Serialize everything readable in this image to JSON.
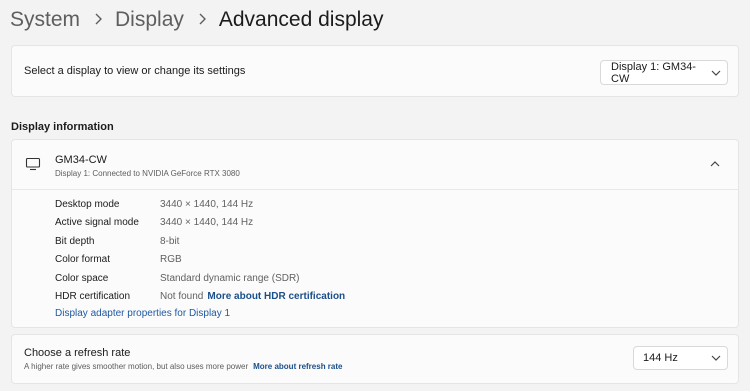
{
  "breadcrumb": {
    "items": [
      "System",
      "Display"
    ],
    "current": "Advanced display"
  },
  "display_select": {
    "label": "Select a display to view or change its settings",
    "value": "Display 1: GM34-CW"
  },
  "display_info": {
    "heading": "Display information",
    "name": "GM34-CW",
    "description": "Display 1: Connected to NVIDIA GeForce RTX 3080",
    "rows": [
      {
        "label": "Desktop mode",
        "value": "3440 × 1440, 144 Hz"
      },
      {
        "label": "Active signal mode",
        "value": "3440 × 1440, 144 Hz"
      },
      {
        "label": "Bit depth",
        "value": "8-bit"
      },
      {
        "label": "Color format",
        "value": "RGB"
      },
      {
        "label": "Color space",
        "value": "Standard dynamic range (SDR)"
      },
      {
        "label": "HDR certification",
        "value": "Not found",
        "link": "More about HDR certification"
      }
    ],
    "adapter_link": "Display adapter properties for Display 1"
  },
  "refresh_rate": {
    "title": "Choose a refresh rate",
    "description": "A higher rate gives smoother motion, but also uses more power",
    "link": "More about refresh rate",
    "value": "144 Hz"
  },
  "icons": {
    "separator": "chevron-right-icon",
    "monitor": "monitor-icon",
    "collapse": "chevron-up-icon",
    "dropdown": "chevron-down-icon"
  },
  "colors": {
    "background": "#f3f3f3",
    "card": "#fbfbfb",
    "link": "#1b4f8a"
  }
}
